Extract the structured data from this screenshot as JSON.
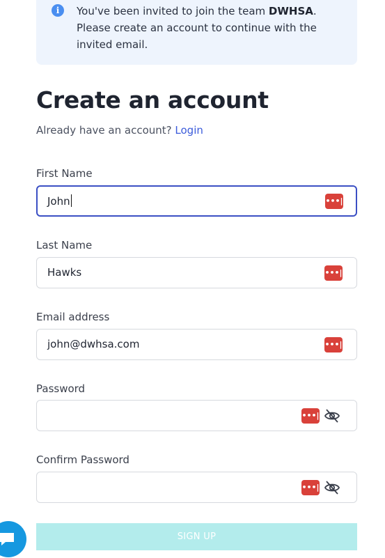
{
  "notice": {
    "icon": "info-icon",
    "text_before": "You've been invited to join the team ",
    "team": "DWHSA",
    "text_after": ". Please create an account to continue with the invited email."
  },
  "header": {
    "title": "Create an account",
    "prompt": "Already have an account?",
    "login_link": "Login"
  },
  "form": {
    "first_name": {
      "label": "First Name",
      "value": "John"
    },
    "last_name": {
      "label": "Last Name",
      "value": "Hawks"
    },
    "email": {
      "label": "Email address",
      "value": "john@dwhsa.com"
    },
    "password": {
      "label": "Password",
      "value": ""
    },
    "confirm_password": {
      "label": "Confirm Password",
      "value": ""
    },
    "password_manager_icon": "password-manager-icon",
    "visibility_icon": "eye-off-icon"
  },
  "actions": {
    "signup_label": "SIGN UP"
  },
  "colors": {
    "accent": "#3b5bdb",
    "notice_bg": "#eef4fd",
    "signup_bg": "#b3ecec",
    "password_manager": "#d9413a",
    "chat": "#1698e0"
  }
}
